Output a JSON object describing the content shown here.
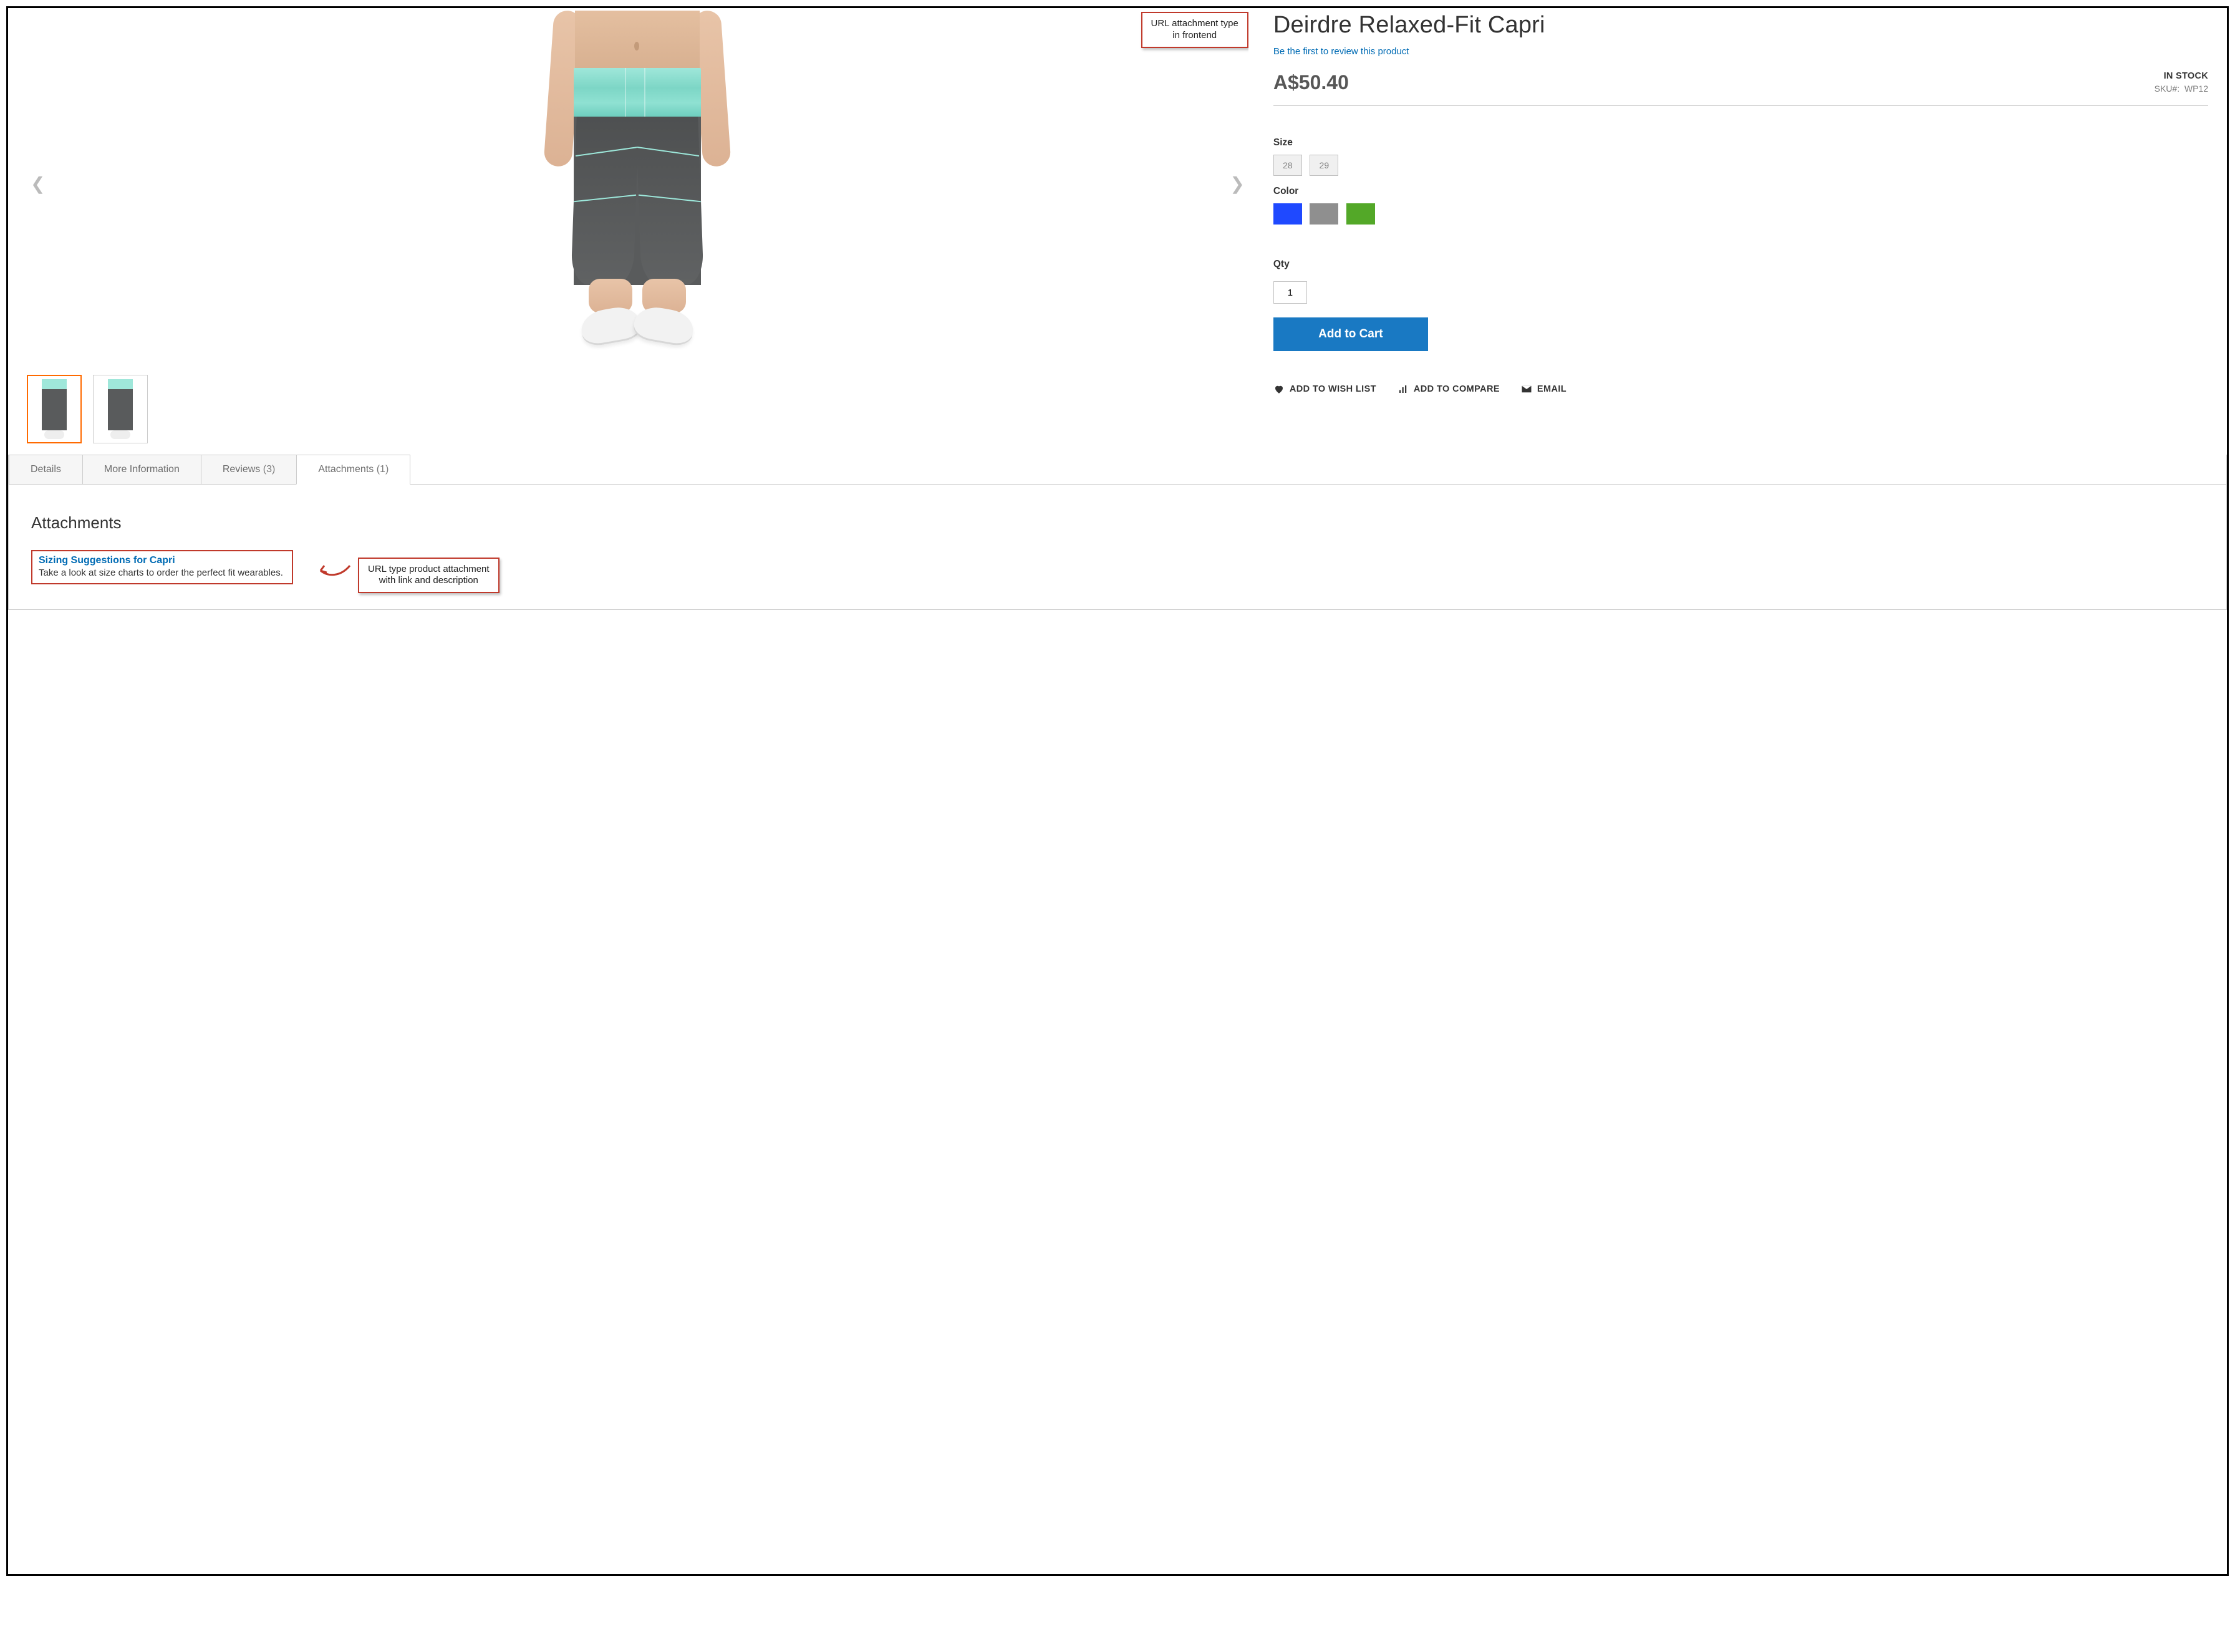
{
  "callouts": {
    "top": "URL attachment type\nin frontend",
    "bottom": "URL type product attachment\nwith link and description"
  },
  "product": {
    "title": "Deirdre Relaxed-Fit Capri",
    "review_cta": "Be the first to review this product",
    "price": "A$50.40",
    "stock_status": "IN STOCK",
    "sku_label": "SKU#:",
    "sku_value": "WP12",
    "size_label": "Size",
    "sizes": [
      "28",
      "29"
    ],
    "color_label": "Color",
    "colors": [
      {
        "name": "blue",
        "css": "c-blue"
      },
      {
        "name": "gray",
        "css": "c-gray"
      },
      {
        "name": "green",
        "css": "c-green"
      }
    ],
    "qty_label": "Qty",
    "qty_value": "1",
    "add_to_cart": "Add to Cart",
    "wishlist": "ADD TO WISH LIST",
    "compare": "ADD TO COMPARE",
    "email": "EMAIL"
  },
  "tabs": {
    "details": {
      "label": "Details"
    },
    "moreinfo": {
      "label": "More Information"
    },
    "reviews": {
      "label": "Reviews",
      "count": "(3)"
    },
    "attachments": {
      "label": "Attachments",
      "count": "(1)"
    }
  },
  "attachments_panel": {
    "heading": "Attachments",
    "item": {
      "title": "Sizing Suggestions for Capri",
      "desc": "Take a look at size charts to order the perfect fit wearables."
    }
  }
}
